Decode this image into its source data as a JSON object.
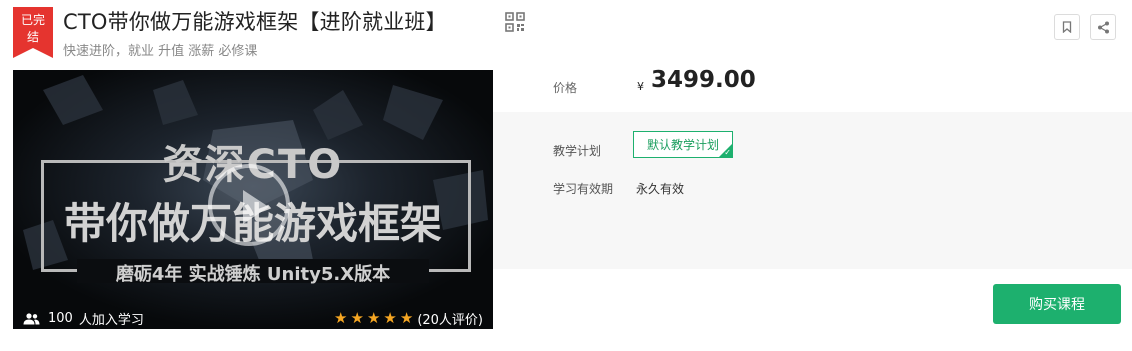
{
  "course": {
    "status_badge": "已完结",
    "title": "CTO带你做万能游戏框架【进阶就业班】",
    "subtitle": "快速进阶，就业 升值 涨薪 必修课"
  },
  "cover": {
    "line1": "资深CTO",
    "line2": "带你做万能游戏框架",
    "line3": "磨砺4年   实战锤炼   Unity5.X版本",
    "learners_count": "100",
    "learners_text": "人加入学习",
    "rating_stars": 5,
    "reviews": "(20人评价)"
  },
  "pricing": {
    "price_label": "价格",
    "currency": "¥",
    "price": "3499.00"
  },
  "plan": {
    "label": "教学计划",
    "selected": "默认教学计划"
  },
  "validity": {
    "label": "学习有效期",
    "value": "永久有效"
  },
  "actions": {
    "buy_label": "购买课程"
  },
  "icons": [
    "qrcode-icon",
    "bookmark-icon",
    "share-icon",
    "users-icon",
    "star-icon",
    "play-icon"
  ],
  "colors": {
    "accent": "#1db06e",
    "badge": "#e5342f",
    "star": "#f5a623"
  }
}
